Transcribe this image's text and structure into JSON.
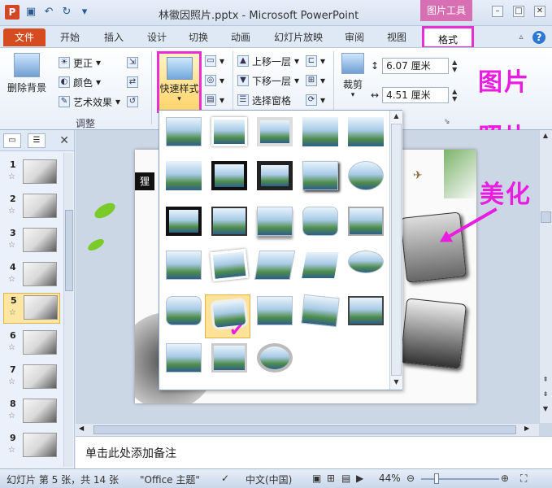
{
  "window": {
    "title": "林徽因照片.pptx - Microsoft PowerPoint",
    "context_group": "图片工具",
    "buttons": [
      "–",
      "□",
      "✕"
    ]
  },
  "tabs": {
    "file": "文件",
    "items": [
      "开始",
      "插入",
      "设计",
      "切换",
      "动画",
      "幻灯片放映",
      "审阅",
      "视图"
    ],
    "active": "格式"
  },
  "ribbon": {
    "remove_bg": "删除背景",
    "adjust": [
      "更正",
      "颜色",
      "艺术效果"
    ],
    "adjust_group_label": "调整",
    "quick_style": "快速样式",
    "arrange": [
      "上移一层",
      "下移一层",
      "选择窗格"
    ],
    "crop": "裁剪",
    "height": "6.07 厘米",
    "width": "4.51 厘米"
  },
  "annotations": {
    "a1": "图片",
    "a2": "照片",
    "a3": "美化"
  },
  "slide_panel": {
    "numbers": [
      "1",
      "2",
      "3",
      "4",
      "5",
      "6",
      "7",
      "8",
      "9"
    ],
    "selected_index": 5
  },
  "slide": {
    "title_fragment": "狸"
  },
  "gallery": {
    "rows": 6,
    "selected": "row 6, column 2"
  },
  "notes": {
    "placeholder": "单击此处添加备注"
  },
  "status": {
    "slide_info": "幻灯片 第 5 张，共 14 张",
    "theme": "\"Office 主题\"",
    "language": "中文(中国)",
    "zoom": "44%"
  }
}
